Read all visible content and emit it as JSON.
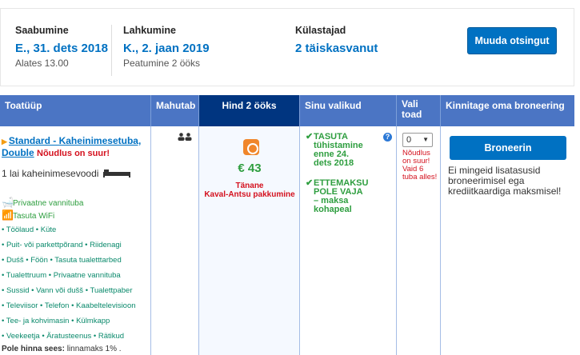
{
  "search": {
    "checkin_label": "Saabumine",
    "checkin_value": "E., 31. dets 2018",
    "checkin_sub": "Alates 13.00",
    "checkout_label": "Lahkumine",
    "checkout_value": "K., 2. jaan 2019",
    "checkout_sub": "Peatumine 2 ööks",
    "guests_label": "Külastajad",
    "guests_value": "2 täiskasvanut",
    "change_button": "Muuda otsingut"
  },
  "table": {
    "headers": {
      "room": "Toatüüp",
      "sleeps": "Mahutab",
      "price": "Hind 2 ööks",
      "choices": "Sinu valikud",
      "select": "Vali toad",
      "confirm": "Kinnitage oma broneering"
    },
    "room": {
      "name": "Standard - Kaheinimesetuba, Double",
      "warning": "Nõudlus on suur!",
      "bed": "1 lai kaheinimesevoodi",
      "highlights": [
        "Privaatne vannituba",
        "Tasuta WiFi"
      ],
      "facilities": [
        "• Töölaud • Küte",
        "• Puit- või parkettpõrand • Riidenagi",
        "• Duśš • Föön • Tasuta tualett­tarbed",
        "• Tualettruum • Privaatne vannituba",
        "• Sussid • Vann või dušš • Tualettpaber",
        "• Televiisor • Telefon • Kaabeltelevisioon",
        "• Tee- ja kohvimasin • Külmkapp",
        "• Veekeetja • Äratusteenus • Rätikud"
      ],
      "included_label": "Pole hinna sees:",
      "included_text": "linnamaks 1% ."
    },
    "price": {
      "amount": "€ 43",
      "deal_line1": "Tänane",
      "deal_line2": "Kaval-Antsu pakkumine"
    },
    "choices": [
      {
        "lines": [
          "TASUTA",
          "tühistamine",
          "enne 24.",
          "dets 2018"
        ]
      },
      {
        "lines": [
          "ETTEMAKSU",
          "POLE VAJA",
          "– maksa",
          "kohapeal"
        ]
      }
    ],
    "select": {
      "value": "0",
      "warning_lines": [
        "Nõudlus",
        "on suur!",
        "Vaid 6",
        "tuba alles!"
      ]
    },
    "confirm": {
      "button": "Broneerin",
      "note": "Ei mingeid lisatasusid broneerimisel ega krediitkaardiga maksmisel!"
    }
  },
  "colors": {
    "accent_blue": "#0071c2",
    "header_blue": "#4b75c4",
    "dark_blue": "#003580",
    "green": "#2e9e3f",
    "red": "#d4111e",
    "orange": "#f0862b"
  }
}
